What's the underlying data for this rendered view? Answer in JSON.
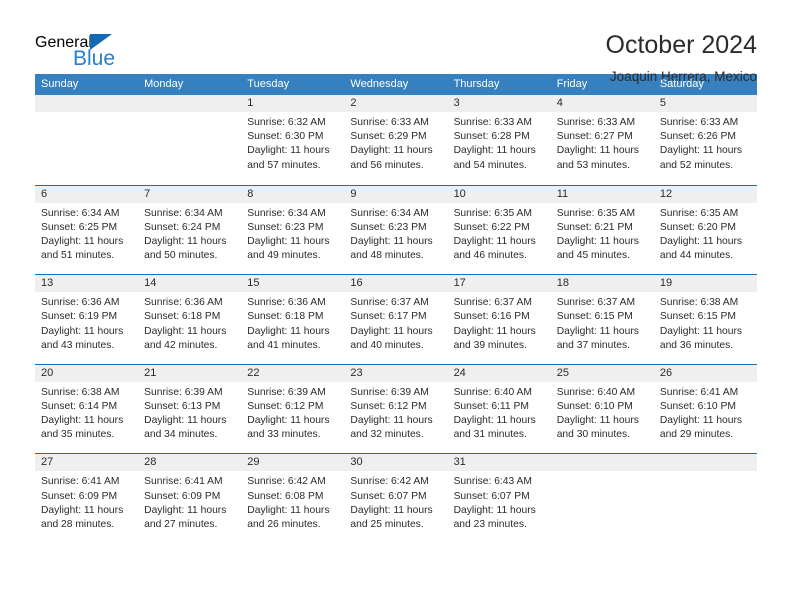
{
  "brand": {
    "name_part1": "General",
    "name_part2": "Blue",
    "triangle_color": "#1268b3",
    "blue_color": "#2a7fc9"
  },
  "header": {
    "title": "October 2024",
    "subtitle": "Joaquin Herrera, Mexico"
  },
  "theme": {
    "header_row_bg": "#3580c0",
    "row_divider": "#1f6db5",
    "daynum_bg": "#efefef",
    "text": "#2b2b2b"
  },
  "weekdays": [
    "Sunday",
    "Monday",
    "Tuesday",
    "Wednesday",
    "Thursday",
    "Friday",
    "Saturday"
  ],
  "weeks": [
    [
      {
        "day": "",
        "sunrise": "",
        "sunset": "",
        "daylight1": "",
        "daylight2": ""
      },
      {
        "day": "",
        "sunrise": "",
        "sunset": "",
        "daylight1": "",
        "daylight2": ""
      },
      {
        "day": "1",
        "sunrise": "Sunrise: 6:32 AM",
        "sunset": "Sunset: 6:30 PM",
        "daylight1": "Daylight: 11 hours",
        "daylight2": "and 57 minutes."
      },
      {
        "day": "2",
        "sunrise": "Sunrise: 6:33 AM",
        "sunset": "Sunset: 6:29 PM",
        "daylight1": "Daylight: 11 hours",
        "daylight2": "and 56 minutes."
      },
      {
        "day": "3",
        "sunrise": "Sunrise: 6:33 AM",
        "sunset": "Sunset: 6:28 PM",
        "daylight1": "Daylight: 11 hours",
        "daylight2": "and 54 minutes."
      },
      {
        "day": "4",
        "sunrise": "Sunrise: 6:33 AM",
        "sunset": "Sunset: 6:27 PM",
        "daylight1": "Daylight: 11 hours",
        "daylight2": "and 53 minutes."
      },
      {
        "day": "5",
        "sunrise": "Sunrise: 6:33 AM",
        "sunset": "Sunset: 6:26 PM",
        "daylight1": "Daylight: 11 hours",
        "daylight2": "and 52 minutes."
      }
    ],
    [
      {
        "day": "6",
        "sunrise": "Sunrise: 6:34 AM",
        "sunset": "Sunset: 6:25 PM",
        "daylight1": "Daylight: 11 hours",
        "daylight2": "and 51 minutes."
      },
      {
        "day": "7",
        "sunrise": "Sunrise: 6:34 AM",
        "sunset": "Sunset: 6:24 PM",
        "daylight1": "Daylight: 11 hours",
        "daylight2": "and 50 minutes."
      },
      {
        "day": "8",
        "sunrise": "Sunrise: 6:34 AM",
        "sunset": "Sunset: 6:23 PM",
        "daylight1": "Daylight: 11 hours",
        "daylight2": "and 49 minutes."
      },
      {
        "day": "9",
        "sunrise": "Sunrise: 6:34 AM",
        "sunset": "Sunset: 6:23 PM",
        "daylight1": "Daylight: 11 hours",
        "daylight2": "and 48 minutes."
      },
      {
        "day": "10",
        "sunrise": "Sunrise: 6:35 AM",
        "sunset": "Sunset: 6:22 PM",
        "daylight1": "Daylight: 11 hours",
        "daylight2": "and 46 minutes."
      },
      {
        "day": "11",
        "sunrise": "Sunrise: 6:35 AM",
        "sunset": "Sunset: 6:21 PM",
        "daylight1": "Daylight: 11 hours",
        "daylight2": "and 45 minutes."
      },
      {
        "day": "12",
        "sunrise": "Sunrise: 6:35 AM",
        "sunset": "Sunset: 6:20 PM",
        "daylight1": "Daylight: 11 hours",
        "daylight2": "and 44 minutes."
      }
    ],
    [
      {
        "day": "13",
        "sunrise": "Sunrise: 6:36 AM",
        "sunset": "Sunset: 6:19 PM",
        "daylight1": "Daylight: 11 hours",
        "daylight2": "and 43 minutes."
      },
      {
        "day": "14",
        "sunrise": "Sunrise: 6:36 AM",
        "sunset": "Sunset: 6:18 PM",
        "daylight1": "Daylight: 11 hours",
        "daylight2": "and 42 minutes."
      },
      {
        "day": "15",
        "sunrise": "Sunrise: 6:36 AM",
        "sunset": "Sunset: 6:18 PM",
        "daylight1": "Daylight: 11 hours",
        "daylight2": "and 41 minutes."
      },
      {
        "day": "16",
        "sunrise": "Sunrise: 6:37 AM",
        "sunset": "Sunset: 6:17 PM",
        "daylight1": "Daylight: 11 hours",
        "daylight2": "and 40 minutes."
      },
      {
        "day": "17",
        "sunrise": "Sunrise: 6:37 AM",
        "sunset": "Sunset: 6:16 PM",
        "daylight1": "Daylight: 11 hours",
        "daylight2": "and 39 minutes."
      },
      {
        "day": "18",
        "sunrise": "Sunrise: 6:37 AM",
        "sunset": "Sunset: 6:15 PM",
        "daylight1": "Daylight: 11 hours",
        "daylight2": "and 37 minutes."
      },
      {
        "day": "19",
        "sunrise": "Sunrise: 6:38 AM",
        "sunset": "Sunset: 6:15 PM",
        "daylight1": "Daylight: 11 hours",
        "daylight2": "and 36 minutes."
      }
    ],
    [
      {
        "day": "20",
        "sunrise": "Sunrise: 6:38 AM",
        "sunset": "Sunset: 6:14 PM",
        "daylight1": "Daylight: 11 hours",
        "daylight2": "and 35 minutes."
      },
      {
        "day": "21",
        "sunrise": "Sunrise: 6:39 AM",
        "sunset": "Sunset: 6:13 PM",
        "daylight1": "Daylight: 11 hours",
        "daylight2": "and 34 minutes."
      },
      {
        "day": "22",
        "sunrise": "Sunrise: 6:39 AM",
        "sunset": "Sunset: 6:12 PM",
        "daylight1": "Daylight: 11 hours",
        "daylight2": "and 33 minutes."
      },
      {
        "day": "23",
        "sunrise": "Sunrise: 6:39 AM",
        "sunset": "Sunset: 6:12 PM",
        "daylight1": "Daylight: 11 hours",
        "daylight2": "and 32 minutes."
      },
      {
        "day": "24",
        "sunrise": "Sunrise: 6:40 AM",
        "sunset": "Sunset: 6:11 PM",
        "daylight1": "Daylight: 11 hours",
        "daylight2": "and 31 minutes."
      },
      {
        "day": "25",
        "sunrise": "Sunrise: 6:40 AM",
        "sunset": "Sunset: 6:10 PM",
        "daylight1": "Daylight: 11 hours",
        "daylight2": "and 30 minutes."
      },
      {
        "day": "26",
        "sunrise": "Sunrise: 6:41 AM",
        "sunset": "Sunset: 6:10 PM",
        "daylight1": "Daylight: 11 hours",
        "daylight2": "and 29 minutes."
      }
    ],
    [
      {
        "day": "27",
        "sunrise": "Sunrise: 6:41 AM",
        "sunset": "Sunset: 6:09 PM",
        "daylight1": "Daylight: 11 hours",
        "daylight2": "and 28 minutes."
      },
      {
        "day": "28",
        "sunrise": "Sunrise: 6:41 AM",
        "sunset": "Sunset: 6:09 PM",
        "daylight1": "Daylight: 11 hours",
        "daylight2": "and 27 minutes."
      },
      {
        "day": "29",
        "sunrise": "Sunrise: 6:42 AM",
        "sunset": "Sunset: 6:08 PM",
        "daylight1": "Daylight: 11 hours",
        "daylight2": "and 26 minutes."
      },
      {
        "day": "30",
        "sunrise": "Sunrise: 6:42 AM",
        "sunset": "Sunset: 6:07 PM",
        "daylight1": "Daylight: 11 hours",
        "daylight2": "and 25 minutes."
      },
      {
        "day": "31",
        "sunrise": "Sunrise: 6:43 AM",
        "sunset": "Sunset: 6:07 PM",
        "daylight1": "Daylight: 11 hours",
        "daylight2": "and 23 minutes."
      },
      {
        "day": "",
        "sunrise": "",
        "sunset": "",
        "daylight1": "",
        "daylight2": ""
      },
      {
        "day": "",
        "sunrise": "",
        "sunset": "",
        "daylight1": "",
        "daylight2": ""
      }
    ]
  ]
}
